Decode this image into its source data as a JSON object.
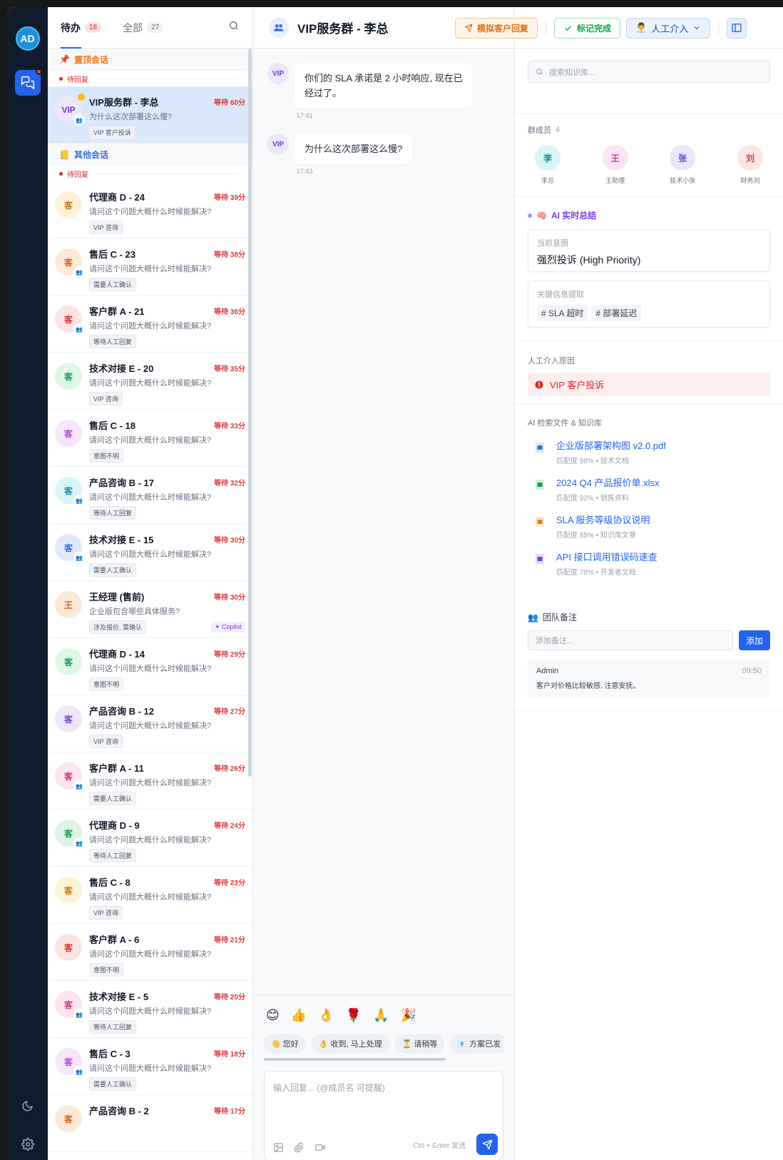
{
  "rail": {
    "avatar": "AD"
  },
  "tabs": [
    {
      "label": "待办",
      "count": "18"
    },
    {
      "label": "全部",
      "count": "27"
    }
  ],
  "pinned_section": "置顶会话",
  "other_section": "其他会话",
  "group_label": "待回复",
  "pinned_conv": {
    "avatar": "VIP",
    "name": "VIP服务群 - 李总",
    "wait": "等待 60分",
    "preview": "为什么这次部署这么慢?",
    "tag": "VIP 客户投诉"
  },
  "conversations": [
    {
      "avatar": "客",
      "name": "代理商 D - 24",
      "wait": "等待 39分",
      "preview": "请问这个问题大概什么时候能解决?",
      "tag": "VIP 咨询",
      "group": false,
      "bg": "#fdf1d6",
      "fg": "#c77d0f"
    },
    {
      "avatar": "客",
      "name": "售后 C - 23",
      "wait": "等待 38分",
      "preview": "请问这个问题大概什么时候能解决?",
      "tag": "需要人工确认",
      "group": true,
      "bg": "#fde9d9",
      "fg": "#d9661e"
    },
    {
      "avatar": "客",
      "name": "客户群 A - 21",
      "wait": "等待 36分",
      "preview": "请问这个问题大概什么时候能解决?",
      "tag": "等待人工回复",
      "group": true,
      "bg": "#fde4e4",
      "fg": "#d33b3b"
    },
    {
      "avatar": "客",
      "name": "技术对接 E - 20",
      "wait": "等待 35分",
      "preview": "请问这个问题大概什么时候能解决?",
      "tag": "VIP 咨询",
      "group": false,
      "bg": "#dcf7e6",
      "fg": "#1f9d55"
    },
    {
      "avatar": "客",
      "name": "售后 C - 18",
      "wait": "等待 33分",
      "preview": "请问这个问题大概什么时候能解决?",
      "tag": "意图不明",
      "group": false,
      "bg": "#f6e6fb",
      "fg": "#b44bd1"
    },
    {
      "avatar": "客",
      "name": "产品咨询 B - 17",
      "wait": "等待 32分",
      "preview": "请问这个问题大概什么时候能解决?",
      "tag": "等待人工回复",
      "group": true,
      "bg": "#d8f5f8",
      "fg": "#1592a6"
    },
    {
      "avatar": "客",
      "name": "技术对接 E - 15",
      "wait": "等待 30分",
      "preview": "请问这个问题大概什么时候能解决?",
      "tag": "需要人工确认",
      "group": true,
      "bg": "#e0e9fb",
      "fg": "#3b6fd8"
    },
    {
      "avatar": "王",
      "name": "王经理 (售前)",
      "wait": "等待 30分",
      "preview": "企业版包含哪些具体服务?",
      "tag": "涉及报价, 需确认",
      "group": false,
      "bg": "#fde9d9",
      "fg": "#d9661e",
      "copilot": "Copilot"
    },
    {
      "avatar": "客",
      "name": "代理商 D - 14",
      "wait": "等待 29分",
      "preview": "请问这个问题大概什么时候能解决?",
      "tag": "意图不明",
      "group": false,
      "bg": "#dcf7e6",
      "fg": "#1f9d55"
    },
    {
      "avatar": "客",
      "name": "产品咨询 B - 12",
      "wait": "等待 27分",
      "preview": "请问这个问题大概什么时候能解决?",
      "tag": "VIP 咨询",
      "group": false,
      "bg": "#eee6fb",
      "fg": "#7c4ad8"
    },
    {
      "avatar": "客",
      "name": "客户群 A - 11",
      "wait": "等待 26分",
      "preview": "请问这个问题大概什么时候能解决?",
      "tag": "需要人工确认",
      "group": true,
      "bg": "#fde4ef",
      "fg": "#d13b7a"
    },
    {
      "avatar": "客",
      "name": "代理商 D - 9",
      "wait": "等待 24分",
      "preview": "请问这个问题大概什么时候能解决?",
      "tag": "等待人工回复",
      "group": true,
      "bg": "#dcf3e6",
      "fg": "#1f9d55"
    },
    {
      "avatar": "客",
      "name": "售后 C - 8",
      "wait": "等待 23分",
      "preview": "请问这个问题大概什么时候能解决?",
      "tag": "VIP 咨询",
      "group": false,
      "bg": "#fdf1d6",
      "fg": "#c77d0f"
    },
    {
      "avatar": "客",
      "name": "客户群 A - 6",
      "wait": "等待 21分",
      "preview": "请问这个问题大概什么时候能解决?",
      "tag": "意图不明",
      "group": false,
      "bg": "#fde4e4",
      "fg": "#d33b3b"
    },
    {
      "avatar": "客",
      "name": "技术对接 E - 5",
      "wait": "等待 20分",
      "preview": "请问这个问题大概什么时候能解决?",
      "tag": "等待人工回复",
      "group": true,
      "bg": "#fde4ef",
      "fg": "#d13b7a"
    },
    {
      "avatar": "客",
      "name": "售后 C - 3",
      "wait": "等待 18分",
      "preview": "请问这个问题大概什么时候能解决?",
      "tag": "需要人工确认",
      "group": true,
      "bg": "#f6e6fb",
      "fg": "#b44bd1"
    },
    {
      "avatar": "客",
      "name": "产品咨询 B - 2",
      "wait": "等待 17分",
      "preview": "",
      "tag": "",
      "group": false,
      "bg": "#fde9d9",
      "fg": "#d9661e"
    }
  ],
  "chat": {
    "title": "VIP服务群 - 李总",
    "messages": [
      {
        "avatar": "VIP",
        "text": "你们的 SLA 承诺是 2 小时响应, 现在已经过了。",
        "time": "17:41"
      },
      {
        "avatar": "VIP",
        "text": "为什么这次部署这么慢?",
        "time": "17:43"
      }
    ],
    "emojis": [
      "😊",
      "👍",
      "👌",
      "🌹",
      "🙏",
      "🎉"
    ],
    "quick_replies": [
      "👋 您好",
      "👌 收到, 马上处理",
      "⏳ 请稍等",
      "📧 方案已发"
    ],
    "input_placeholder": "输入回复... (@成员名 可提醒)",
    "send_hint": "Ctrl + Enter 发送"
  },
  "actions": {
    "simulate": "模拟客户回复",
    "done": "标记完成",
    "human": "人工介入"
  },
  "side": {
    "kb_placeholder": "搜索知识库...",
    "members_title": "群成员",
    "members_count": "4",
    "members": [
      {
        "initial": "李",
        "name": "李总",
        "bg": "#d6f5f7",
        "fg": "#138a9c"
      },
      {
        "initial": "王",
        "name": "王助理",
        "bg": "#fbe4f4",
        "fg": "#c23b96"
      },
      {
        "initial": "张",
        "name": "技术小张",
        "bg": "#e8e6fb",
        "fg": "#5b4bd1"
      },
      {
        "initial": "刘",
        "name": "财务刘",
        "bg": "#fde4e4",
        "fg": "#d33b3b"
      }
    ],
    "ai_title": "AI 实时总结",
    "intent_label": "当前意图",
    "intent_value": "强烈投诉 (High Priority)",
    "keyinfo_label": "关键信息提取",
    "keywords": [
      "# SLA 超时",
      "# 部署延迟"
    ],
    "reason_title": "人工介入原因",
    "reason_value": "VIP 客户投诉",
    "files_title": "AI 检索文件 & 知识库",
    "files": [
      {
        "name": "企业版部署架构图 v2.0.pdf",
        "meta": "匹配度 98% • 技术文档",
        "color": "#3b6fd8"
      },
      {
        "name": "2024 Q4 产品报价单.xlsx",
        "meta": "匹配度 92% • 销售资料",
        "color": "#16a34a"
      },
      {
        "name": "SLA 服务等级协议说明",
        "meta": "匹配度 85% • 知识库文章",
        "color": "#ea7a14"
      },
      {
        "name": "API 接口调用错误码速查",
        "meta": "匹配度 78% • 开发者文档",
        "color": "#7c3aed"
      }
    ],
    "notes_title": "团队备注",
    "notes_placeholder": "添加备注...",
    "notes_add": "添加",
    "note": {
      "author": "Admin",
      "time": "09:50",
      "text": "客户对价格比较敏感, 注意安抚。"
    }
  }
}
